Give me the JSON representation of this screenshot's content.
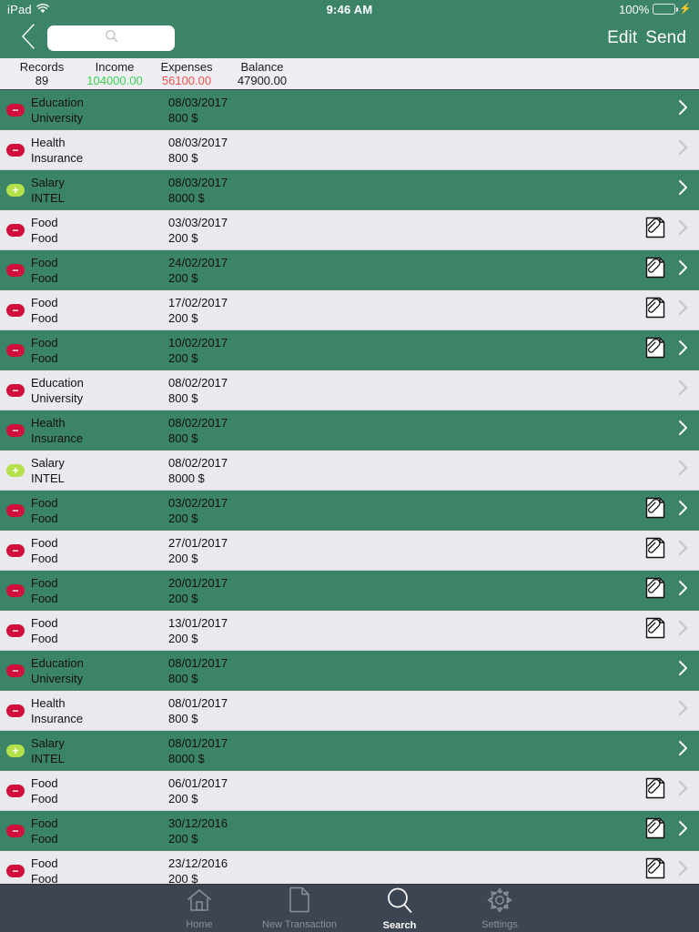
{
  "status_bar": {
    "device": "iPad",
    "wifi_icon": "wifi-icon",
    "time": "9:46 AM",
    "battery_percent": "100%",
    "battery_icon": "battery-icon",
    "charging_icon": "lightning-bolt-icon"
  },
  "nav": {
    "back_icon": "chevron-left-icon",
    "search_icon": "search-icon",
    "search_value": "",
    "search_placeholder": "",
    "edit_label": "Edit",
    "send_label": "Send"
  },
  "stats": {
    "records_label": "Records",
    "records_value": "89",
    "income_label": "Income",
    "income_value": "104000.00",
    "expenses_label": "Expenses",
    "expenses_value": "56100.00",
    "balance_label": "Balance",
    "balance_value": "47900.00",
    "income_color": "#3FD152",
    "expenses_color": "#F2504B"
  },
  "colors": {
    "green_row": "#3C8468",
    "plain_row": "#EAE9EE",
    "tabbar": "#3E4552",
    "negative_badge": "#D0103A",
    "positive_badge": "#B3E04B"
  },
  "transactions": [
    {
      "type": "expense",
      "badge": "minus-circle-icon",
      "category": "Education",
      "subcategory": "University",
      "date": "08/03/2017",
      "amount": "800 $",
      "attachment": false,
      "shaded": true
    },
    {
      "type": "expense",
      "badge": "minus-circle-icon",
      "category": "Health",
      "subcategory": "Insurance",
      "date": "08/03/2017",
      "amount": "800 $",
      "attachment": false,
      "shaded": false
    },
    {
      "type": "income",
      "badge": "plus-circle-icon",
      "category": "Salary",
      "subcategory": "INTEL",
      "date": "08/03/2017",
      "amount": "8000 $",
      "attachment": false,
      "shaded": true
    },
    {
      "type": "expense",
      "badge": "minus-circle-icon",
      "category": "Food",
      "subcategory": "Food",
      "date": "03/03/2017",
      "amount": "200 $",
      "attachment": true,
      "shaded": false
    },
    {
      "type": "expense",
      "badge": "minus-circle-icon",
      "category": "Food",
      "subcategory": "Food",
      "date": "24/02/2017",
      "amount": "200 $",
      "attachment": true,
      "shaded": true
    },
    {
      "type": "expense",
      "badge": "minus-circle-icon",
      "category": "Food",
      "subcategory": "Food",
      "date": "17/02/2017",
      "amount": "200 $",
      "attachment": true,
      "shaded": false
    },
    {
      "type": "expense",
      "badge": "minus-circle-icon",
      "category": "Food",
      "subcategory": "Food",
      "date": "10/02/2017",
      "amount": "200 $",
      "attachment": true,
      "shaded": true
    },
    {
      "type": "expense",
      "badge": "minus-circle-icon",
      "category": "Education",
      "subcategory": "University",
      "date": "08/02/2017",
      "amount": "800 $",
      "attachment": false,
      "shaded": false
    },
    {
      "type": "expense",
      "badge": "minus-circle-icon",
      "category": "Health",
      "subcategory": "Insurance",
      "date": "08/02/2017",
      "amount": "800 $",
      "attachment": false,
      "shaded": true
    },
    {
      "type": "income",
      "badge": "plus-circle-icon",
      "category": "Salary",
      "subcategory": "INTEL",
      "date": "08/02/2017",
      "amount": "8000 $",
      "attachment": false,
      "shaded": false
    },
    {
      "type": "expense",
      "badge": "minus-circle-icon",
      "category": "Food",
      "subcategory": "Food",
      "date": "03/02/2017",
      "amount": "200 $",
      "attachment": true,
      "shaded": true
    },
    {
      "type": "expense",
      "badge": "minus-circle-icon",
      "category": "Food",
      "subcategory": "Food",
      "date": "27/01/2017",
      "amount": "200 $",
      "attachment": true,
      "shaded": false
    },
    {
      "type": "expense",
      "badge": "minus-circle-icon",
      "category": "Food",
      "subcategory": "Food",
      "date": "20/01/2017",
      "amount": "200 $",
      "attachment": true,
      "shaded": true
    },
    {
      "type": "expense",
      "badge": "minus-circle-icon",
      "category": "Food",
      "subcategory": "Food",
      "date": "13/01/2017",
      "amount": "200 $",
      "attachment": true,
      "shaded": false
    },
    {
      "type": "expense",
      "badge": "minus-circle-icon",
      "category": "Education",
      "subcategory": "University",
      "date": "08/01/2017",
      "amount": "800 $",
      "attachment": false,
      "shaded": true
    },
    {
      "type": "expense",
      "badge": "minus-circle-icon",
      "category": "Health",
      "subcategory": "Insurance",
      "date": "08/01/2017",
      "amount": "800 $",
      "attachment": false,
      "shaded": false
    },
    {
      "type": "income",
      "badge": "plus-circle-icon",
      "category": "Salary",
      "subcategory": "INTEL",
      "date": "08/01/2017",
      "amount": "8000 $",
      "attachment": false,
      "shaded": true
    },
    {
      "type": "expense",
      "badge": "minus-circle-icon",
      "category": "Food",
      "subcategory": "Food",
      "date": "06/01/2017",
      "amount": "200 $",
      "attachment": true,
      "shaded": false
    },
    {
      "type": "expense",
      "badge": "minus-circle-icon",
      "category": "Food",
      "subcategory": "Food",
      "date": "30/12/2016",
      "amount": "200 $",
      "attachment": true,
      "shaded": true
    },
    {
      "type": "expense",
      "badge": "minus-circle-icon",
      "category": "Food",
      "subcategory": "Food",
      "date": "23/12/2016",
      "amount": "200 $",
      "attachment": true,
      "shaded": false
    }
  ],
  "tabs": [
    {
      "label": "Home",
      "icon": "home-icon",
      "active": false
    },
    {
      "label": "New Transaction",
      "icon": "document-icon",
      "active": false
    },
    {
      "label": "Search",
      "icon": "search-icon",
      "active": true
    },
    {
      "label": "Settings",
      "icon": "gear-icon",
      "active": false
    }
  ]
}
